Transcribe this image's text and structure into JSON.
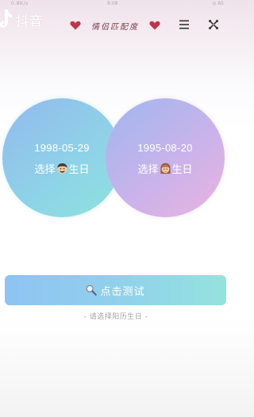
{
  "status_bar": {
    "left": "0.8K/s",
    "center": "8:08",
    "right": "◎ 85"
  },
  "app": {
    "name": "抖音"
  },
  "header": {
    "title": "情侣匹配度"
  },
  "male": {
    "date": "1998-05-29",
    "label_prefix": "选择",
    "label_suffix": "生日",
    "avatar_icon": "man-face-icon"
  },
  "female": {
    "date": "1995-08-20",
    "label_prefix": "选择",
    "label_suffix": "生日",
    "avatar_icon": "woman-face-icon"
  },
  "test_button": {
    "label": "点击测试"
  },
  "hint": "- 请选择阳历生日 -",
  "colors": {
    "heart": "#c0344b",
    "button_start": "#8ec3f3",
    "button_end": "#94e3de",
    "male_circle": "#8ed6e6",
    "female_circle": "#eab3df"
  }
}
